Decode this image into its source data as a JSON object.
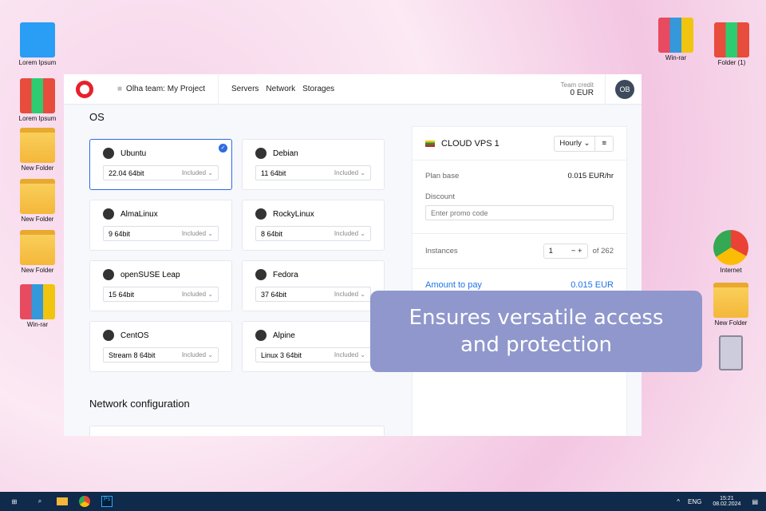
{
  "desktop": {
    "left": [
      "Lorem Ipsum",
      "Lorem Ipsum",
      "New Folder",
      "New Folder",
      "New Folder",
      "Win-rar"
    ],
    "right": [
      "Win-rar",
      "Folder (1)",
      "Internet",
      "New Folder"
    ]
  },
  "header": {
    "project": "Olha team: My Project",
    "nav": [
      "Servers",
      "Network",
      "Storages"
    ],
    "credit_label": "Team credit",
    "credit_value": "0 EUR",
    "avatar": "OB"
  },
  "os_title": "OS",
  "os_cards": [
    {
      "name": "Ubuntu",
      "version": "22.04 64bit",
      "price": "Included",
      "selected": true
    },
    {
      "name": "Debian",
      "version": "11 64bit",
      "price": "Included"
    },
    {
      "name": "AlmaLinux",
      "version": "9 64bit",
      "price": "Included"
    },
    {
      "name": "RockyLinux",
      "version": "8 64bit",
      "price": "Included"
    },
    {
      "name": "openSUSE Leap",
      "version": "15 64bit",
      "price": "Included"
    },
    {
      "name": "Fedora",
      "version": "37 64bit",
      "price": "Included"
    },
    {
      "name": "CentOS",
      "version": "Stream 8 64bit",
      "price": "Included"
    },
    {
      "name": "Alpine",
      "version": "Linux 3 64bit",
      "price": "Included"
    }
  ],
  "network_title": "Network configuration",
  "summary": {
    "plan": "CLOUD VPS 1",
    "billing": "Hourly",
    "plan_base_label": "Plan base",
    "plan_base_value": "0.015 EUR/hr",
    "discount_label": "Discount",
    "promo_placeholder": "Enter promo code",
    "instances_label": "Instances",
    "instances_value": "1",
    "instances_max": "of 262",
    "amount_label": "Amount to pay",
    "amount_value": "0.015 EUR"
  },
  "banner": "Ensures versatile access and protection",
  "taskbar": {
    "lang": "ENG",
    "time": "15:21",
    "date": "08.02.2024"
  }
}
